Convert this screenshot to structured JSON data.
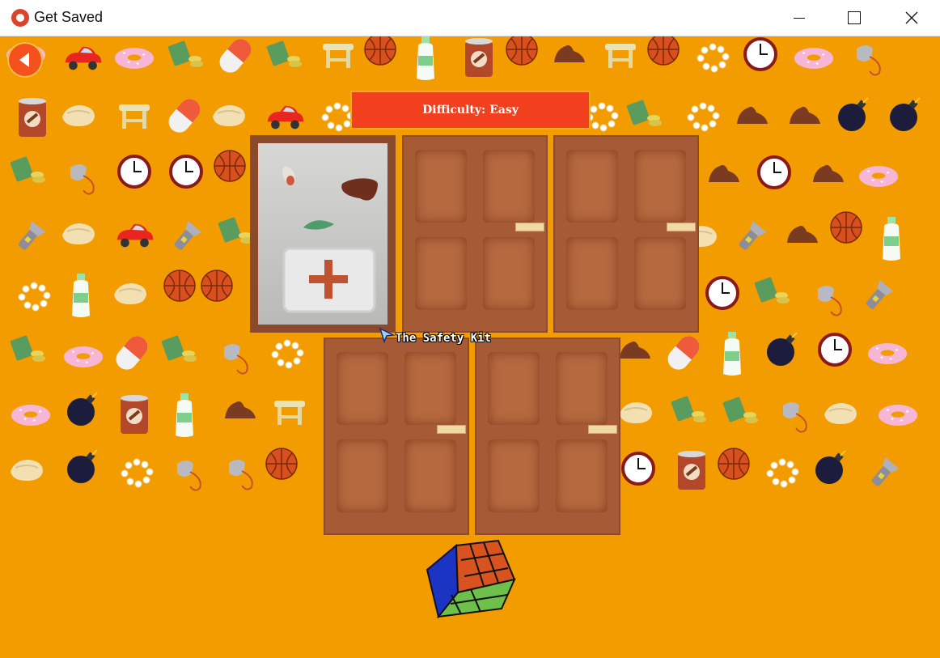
{
  "window": {
    "title": "Get Saved"
  },
  "controls": {
    "minimize": "minimize",
    "maximize": "maximize",
    "close": "close"
  },
  "game": {
    "difficulty_label": "Difficulty: Easy",
    "selected_item_label": "The Safety Kit",
    "doors": [
      {
        "state": "open",
        "content": "safety-kit"
      },
      {
        "state": "closed"
      },
      {
        "state": "closed"
      },
      {
        "state": "closed"
      },
      {
        "state": "closed"
      }
    ]
  },
  "colors": {
    "background": "#f39c00",
    "banner": "#f2401f",
    "door": "#a65a36",
    "back_button": "#f4511e"
  },
  "icons": {
    "back": "back-arrow-icon",
    "background_items": [
      "donut",
      "toy-car",
      "money",
      "pill",
      "stool",
      "basketball",
      "water-bottle",
      "canned-food",
      "pastry",
      "clock",
      "pearl-necklace",
      "shoe",
      "bomb",
      "flashlight",
      "whistle"
    ]
  }
}
